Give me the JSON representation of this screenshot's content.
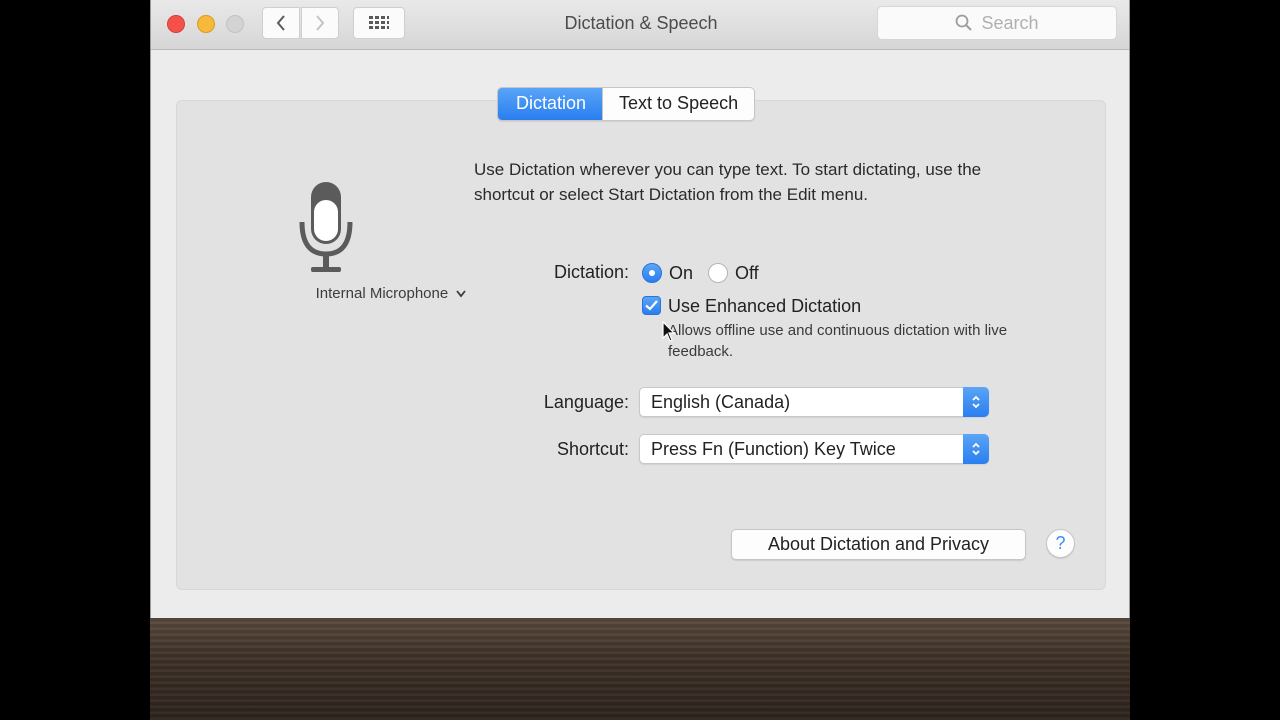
{
  "window": {
    "title": "Dictation & Speech"
  },
  "toolbar": {
    "back_icon": "chevron-left-icon",
    "forward_icon": "chevron-right-icon",
    "grid_icon": "grid-icon",
    "search_placeholder": "Search"
  },
  "tabs": [
    {
      "label": "Dictation",
      "selected": true
    },
    {
      "label": "Text to Speech",
      "selected": false
    }
  ],
  "microphone": {
    "label": "Internal Microphone",
    "icon": "microphone-icon"
  },
  "intro_text": "Use Dictation wherever you can type text. To start dictating, use the shortcut or select Start Dictation from the Edit menu.",
  "dictation": {
    "label": "Dictation:",
    "on_label": "On",
    "off_label": "Off",
    "selected": "On"
  },
  "enhanced": {
    "label": "Use Enhanced Dictation",
    "checked": true,
    "description": "Allows offline use and continuous dictation with live feedback."
  },
  "language": {
    "label": "Language:",
    "value": "English (Canada)"
  },
  "shortcut": {
    "label": "Shortcut:",
    "value": "Press Fn (Function) Key Twice"
  },
  "about_button": "About Dictation and Privacy",
  "help_button": "?",
  "colors": {
    "accent": "#2a7ef0",
    "close": "#f4514b",
    "minimize": "#f6b93a"
  }
}
